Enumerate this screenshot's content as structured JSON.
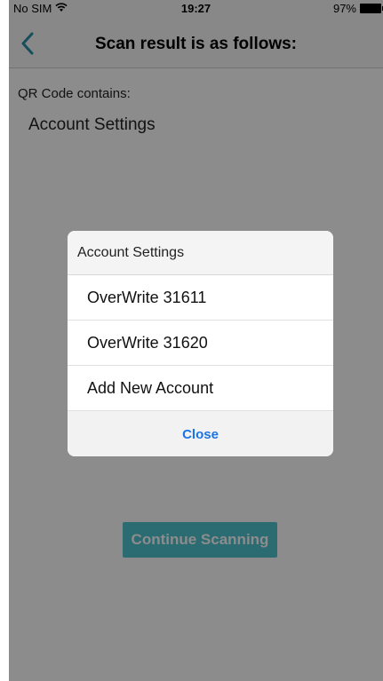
{
  "status_bar": {
    "carrier": "No SIM",
    "time": "19:27",
    "battery": "97%"
  },
  "nav": {
    "title": "Scan result is as follows:"
  },
  "content": {
    "label": "QR Code contains:",
    "value": "Account Settings"
  },
  "dialog": {
    "title": "Account Settings",
    "items": [
      {
        "label": "OverWrite 31611"
      },
      {
        "label": "OverWrite 31620"
      },
      {
        "label": "Add New Account"
      }
    ],
    "close_label": "Close"
  },
  "continue_button": {
    "label": "Continue Scanning"
  },
  "colors": {
    "accent_teal": "#4fc3cf",
    "link_blue": "#1a73e8",
    "back_arrow": "#2a8fa8"
  }
}
